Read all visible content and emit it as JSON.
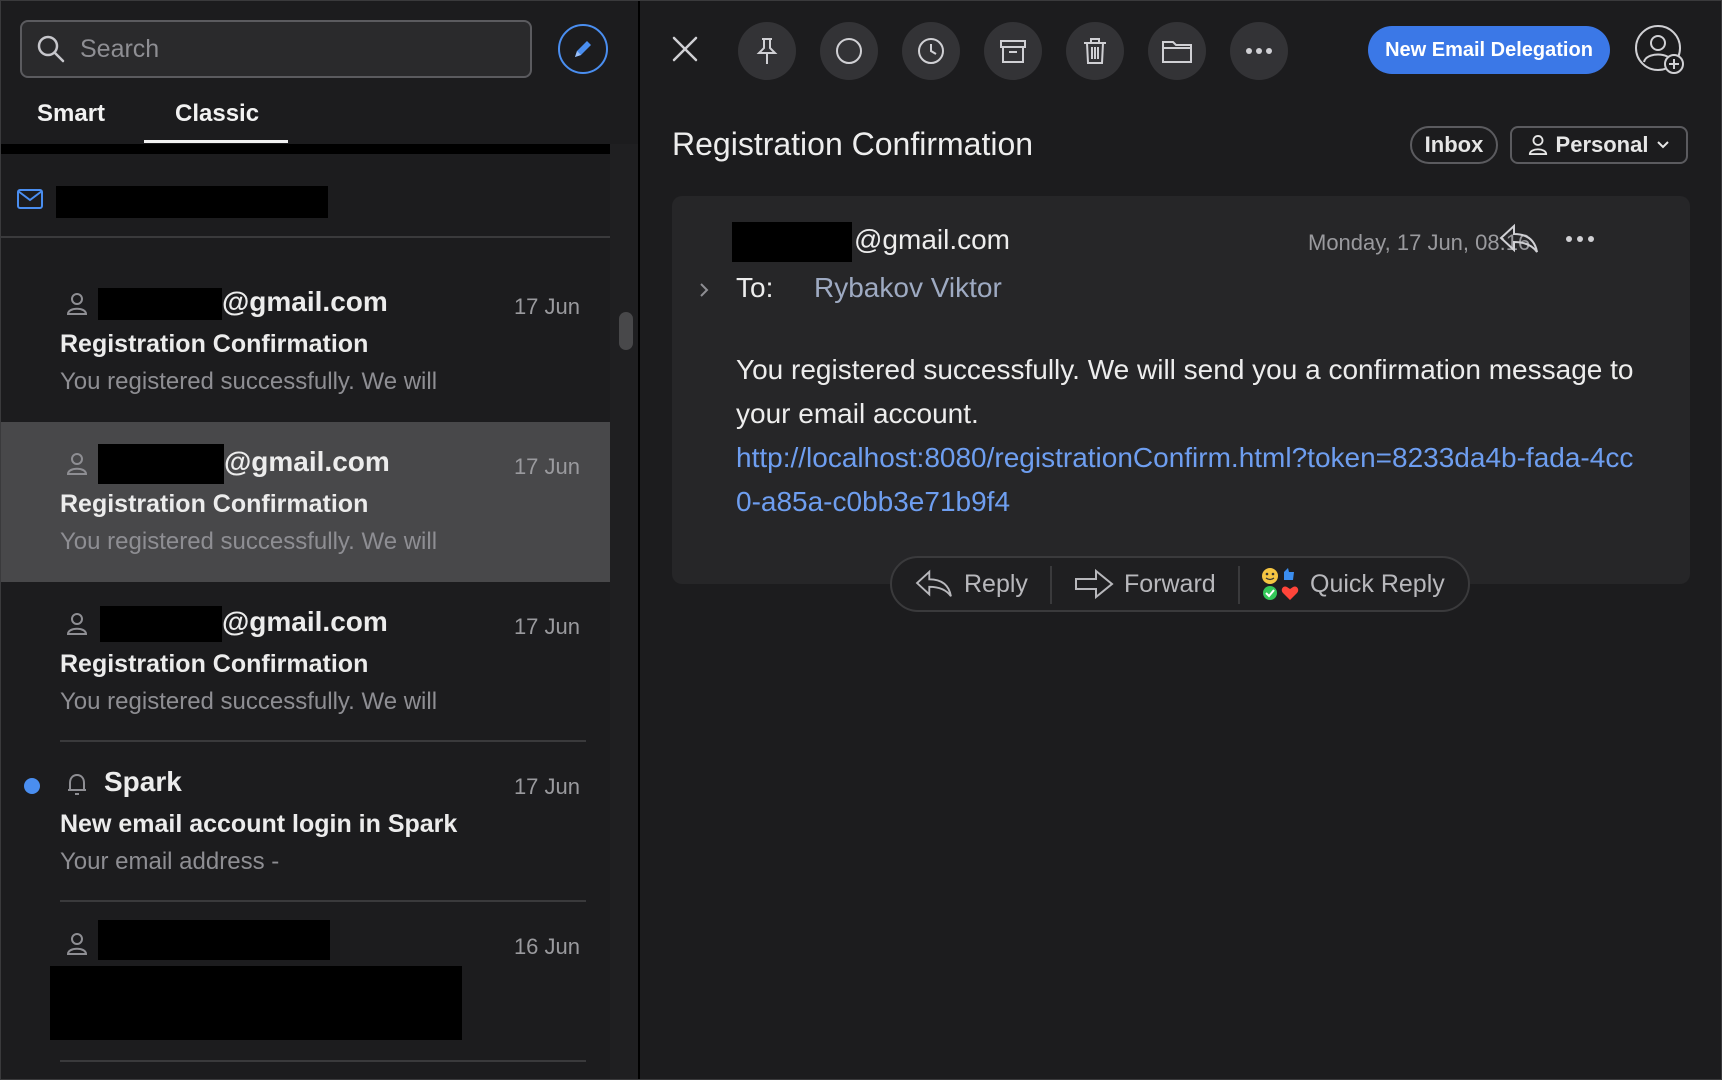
{
  "search": {
    "placeholder": "Search"
  },
  "tabs": [
    "Smart",
    "Classic"
  ],
  "messages": [
    {
      "sender_suffix": "@gmail.com",
      "date": "17 Jun",
      "subject": "Registration Confirmation",
      "preview": "You registered successfully. We will"
    },
    {
      "sender_suffix": "@gmail.com",
      "date": "17 Jun",
      "subject": "Registration Confirmation",
      "preview": "You registered successfully. We will"
    },
    {
      "sender_suffix": "@gmail.com",
      "date": "17 Jun",
      "subject": "Registration Confirmation",
      "preview": "You registered successfully. We will"
    },
    {
      "sender": "Spark",
      "date": "17 Jun",
      "subject": "New email account login in Spark",
      "preview": "Your email address -"
    },
    {
      "date": "16 Jun"
    }
  ],
  "toolbar": {
    "delegation_label": "New Email Delegation"
  },
  "email": {
    "subject": "Registration Confirmation",
    "chips": {
      "inbox": "Inbox",
      "personal": "Personal"
    },
    "from_suffix": "@gmail.com",
    "datetime": "Monday, 17 Jun, 08:16",
    "to_label": "To:",
    "to_name": "Rybakov Viktor",
    "body": "You registered successfully. We will send you a confirmation message to your email account.",
    "link": "http://localhost:8080/registrationConfirm.html?token=8233da4b-fada-4cc0-a85a-c0bb3e71b9f4"
  },
  "actions": {
    "reply": "Reply",
    "forward": "Forward",
    "quick_reply": "Quick Reply"
  },
  "colors": {
    "accent": "#3b78e7",
    "link": "#6e9ef0",
    "unread": "#4a8ef0"
  }
}
